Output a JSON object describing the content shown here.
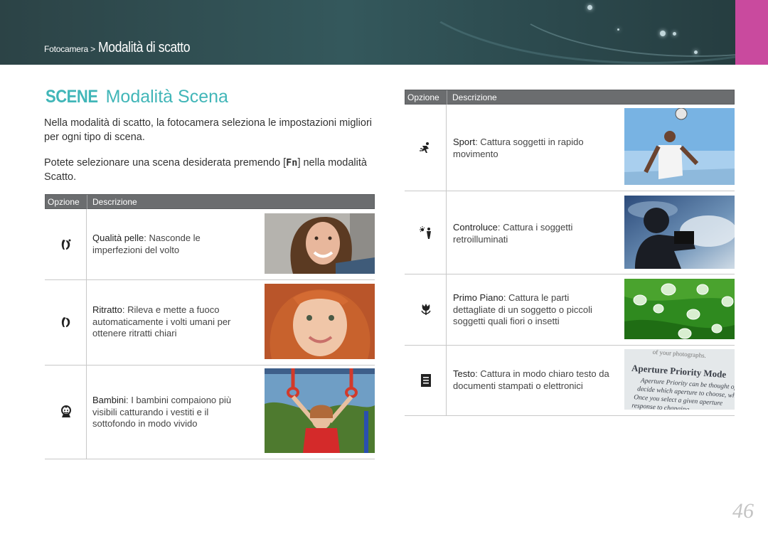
{
  "header": {
    "breadcrumb_small": "Fotocamera >",
    "breadcrumb_big": "Modalità di scatto"
  },
  "section": {
    "scene_label": "SCENE",
    "title": "Modalità Scena",
    "para1": "Nella modalità di scatto, la fotocamera seleziona le impostazioni migliori per ogni tipo di scena.",
    "para2_before": "Potete selezionare una scena desiderata premendo [",
    "para2_key": "Fn",
    "para2_after": "] nella modalità Scatto."
  },
  "table_headers": {
    "option": "Opzione",
    "description": "Descrizione"
  },
  "left_rows": [
    {
      "icon": "beauty-face-icon",
      "term": "Qualità pelle",
      "text": ": Nasconde le imperfezioni del volto",
      "photo": "smiling-girl-photo"
    },
    {
      "icon": "portrait-icon",
      "term": "Ritratto",
      "text": ": Rileva e mette a fuoco automaticamente i volti umani per ottenere ritratti chiari",
      "photo": "red-haired-girl-photo"
    },
    {
      "icon": "children-icon",
      "term": "Bambini",
      "text": ": I bambini compaiono più visibili catturando i vestiti e il sottofondo in modo vivido",
      "photo": "child-on-rings-photo"
    }
  ],
  "right_rows": [
    {
      "icon": "sports-icon",
      "term": "Sport",
      "text": ": Cattura soggetti in rapido movimento",
      "photo": "football-player-photo"
    },
    {
      "icon": "backlight-icon",
      "term": "Controluce",
      "text": ": Cattura i soggetti retroilluminati",
      "photo": "silhouette-photographer-photo"
    },
    {
      "icon": "macro-flower-icon",
      "term": "Primo Piano",
      "text": ": Cattura le parti dettagliate di un soggetto o piccoli soggetti quali fiori o insetti",
      "photo": "water-drops-leaf-photo"
    },
    {
      "icon": "text-document-icon",
      "term": "Testo",
      "text": ": Cattura in modo chiaro testo da documenti stampati o elettronici",
      "photo": "printed-text-photo"
    }
  ],
  "text_photo": {
    "line0": "of your photographs.",
    "line1": "Aperture Priority Mode",
    "line2": "Aperture Priority can be thought of",
    "line3": "decide which aperture to choose, whi",
    "line4": "Once you select a given aperture",
    "line5": "response to changing"
  },
  "page_number": "46"
}
